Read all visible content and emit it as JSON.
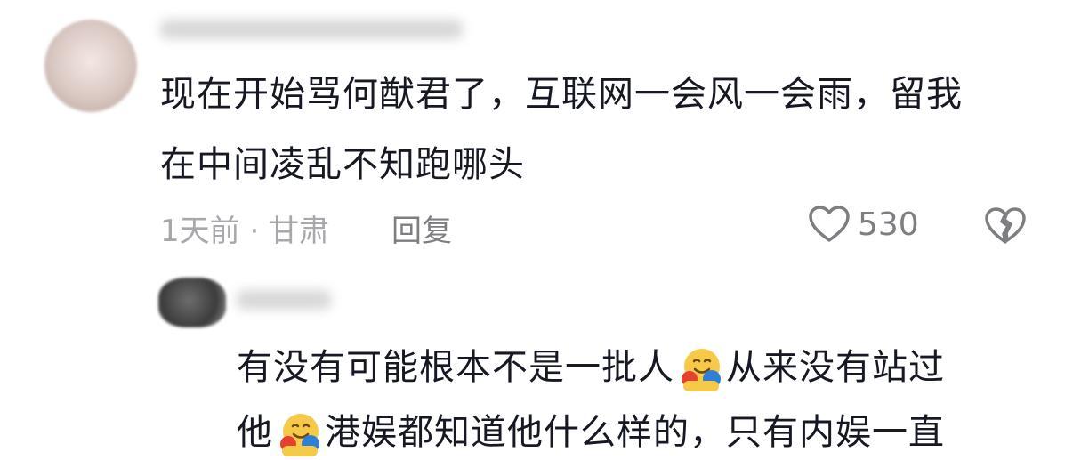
{
  "comments": [
    {
      "text_line1": "现在开始骂何猷君了，互联网一会风一会雨，留我",
      "text_line2": "在中间凌乱不知跑哪头",
      "time": "1天前 · 甘肃",
      "reply_label": "回复",
      "likes": "530"
    },
    {
      "line1_part1": "有没有可能根本不是一批人",
      "line1_part2": "从来没有站过",
      "line2_part1": "他",
      "line2_part2": "港娱都知道他什么样的，只有内娱一直"
    }
  ],
  "icons": {
    "like": "heart-outline-icon",
    "dislike": "broken-heart-icon",
    "emoji": "hugging-face-emoji"
  },
  "colors": {
    "text": "#161823",
    "meta": "#a7a8ac",
    "icon": "#7d7e82"
  }
}
